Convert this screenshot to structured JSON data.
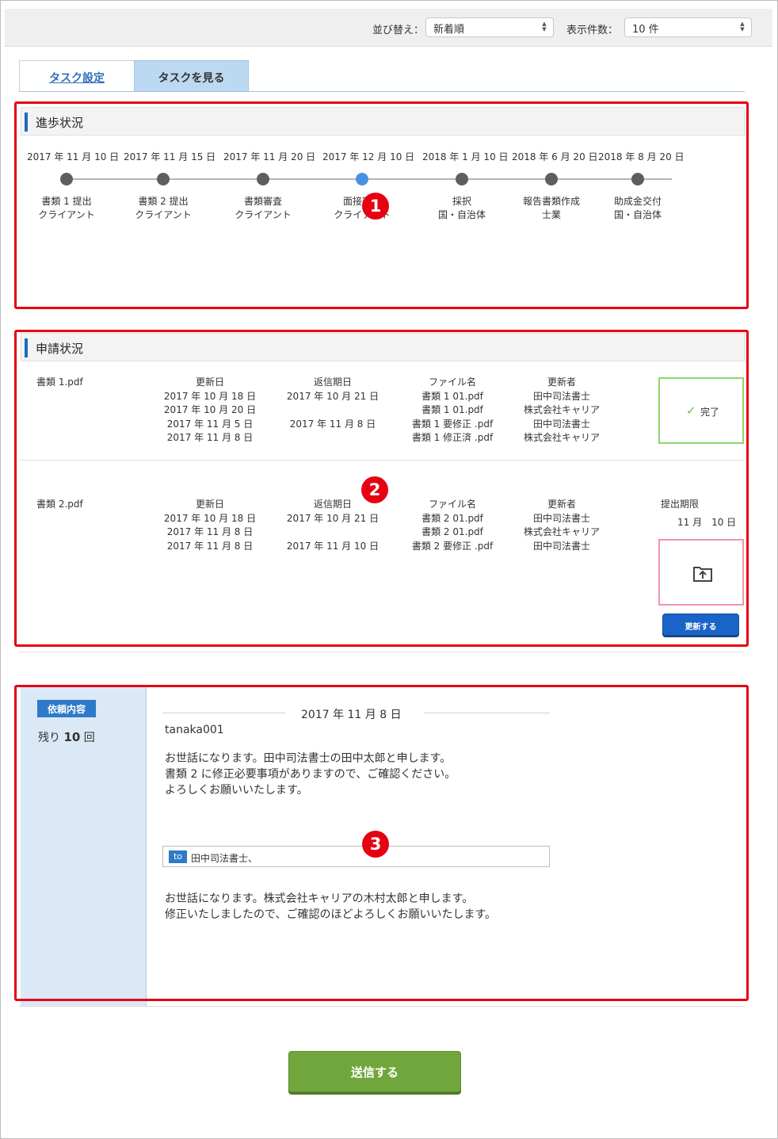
{
  "toolbar": {
    "sort_label": "並び替え：",
    "sort_value": "新着順",
    "count_label": "表示件数：",
    "count_value": "10 件"
  },
  "tabs": [
    {
      "label": "タスク設定",
      "active": false
    },
    {
      "label": "タスクを見る",
      "active": true
    }
  ],
  "annotations": [
    "1",
    "2",
    "3"
  ],
  "progress": {
    "title": "進歩状況",
    "steps": [
      {
        "date": "2017 年 11 月 10 日",
        "line1": "書類 1 提出",
        "line2": "クライアント",
        "active": false
      },
      {
        "date": "2017 年 11 月 15 日",
        "line1": "書類 2 提出",
        "line2": "クライアント",
        "active": false
      },
      {
        "date": "2017 年 11 月 20 日",
        "line1": "書類審査",
        "line2": "クライアント",
        "active": false
      },
      {
        "date": "2017 年 12 月 10 日",
        "line1": "面接審査",
        "line2": "クライアント",
        "active": true
      },
      {
        "date": "2018 年 1 月 10 日",
        "line1": "採択",
        "line2": "国・自治体",
        "active": false
      },
      {
        "date": "2018 年 6 月 20 日",
        "line1": "報告書類作成",
        "line2": "士業",
        "active": false
      },
      {
        "date": "2018 年 8 月 20 日",
        "line1": "助成金交付",
        "line2": "国・自治体",
        "active": false
      }
    ]
  },
  "application": {
    "title": "申請状況",
    "headers": {
      "updated": "更新日",
      "reply": "返信期日",
      "file": "ファイル名",
      "updater": "更新者",
      "deadline": "提出期限"
    },
    "rows": [
      {
        "doc": "書類 1.pdf",
        "updated": [
          "2017 年 10 月 18 日",
          "2017 年 10 月 20 日",
          "2017 年 11 月 5 日",
          "2017 年 11 月 8 日"
        ],
        "reply": [
          "2017 年 10 月 21 日",
          "",
          "2017 年 11 月 8 日",
          ""
        ],
        "files": [
          "書類 1 01.pdf",
          "書類 1 01.pdf",
          "書類 1 要修正 .pdf",
          "書類 1 修正済 .pdf"
        ],
        "updaters": [
          "田中司法書士",
          "株式会社キャリア",
          "田中司法書士",
          "株式会社キャリア"
        ],
        "status": "完了"
      },
      {
        "doc": "書類 2.pdf",
        "updated": [
          "2017 年 10 月 18 日",
          "2017 年 11 月 8 日",
          "2017 年 11 月 8 日"
        ],
        "reply": [
          "2017 年 10 月 21 日",
          "",
          "2017 年 11 月 10 日"
        ],
        "files": [
          "書類 2 01.pdf",
          "書類 2 01.pdf",
          "書類 2 要修正 .pdf"
        ],
        "updaters": [
          "田中司法書士",
          "株式会社キャリア",
          "田中司法書士"
        ],
        "deadline": "11 月　10 日",
        "update_button": "更新する"
      }
    ]
  },
  "request": {
    "tag": "依頼内容",
    "remaining_prefix": "残り",
    "remaining_count": "10",
    "remaining_suffix": "回",
    "date": "2017 年 11 月 8 日",
    "sender": "tanaka001",
    "message": [
      "お世話になります。田中司法書士の田中太郎と申します。",
      "書類 2 に修正必要事項がありますので、ご確認ください。",
      "よろしくお願いいたします。"
    ],
    "to_label": "to",
    "to_name": "田中司法書士、",
    "reply": [
      "お世話になります。株式会社キャリアの木村太郎と申します。",
      "修正いたしましたので、ご確認のほどよろしくお願いいたします。"
    ]
  },
  "send_button": "送信する",
  "colors": {
    "accent": "#1e6cb8",
    "annotation": "#e60012",
    "send": "#71a63d",
    "done_border": "#8ed66b",
    "upload_border": "#ef95a9"
  }
}
